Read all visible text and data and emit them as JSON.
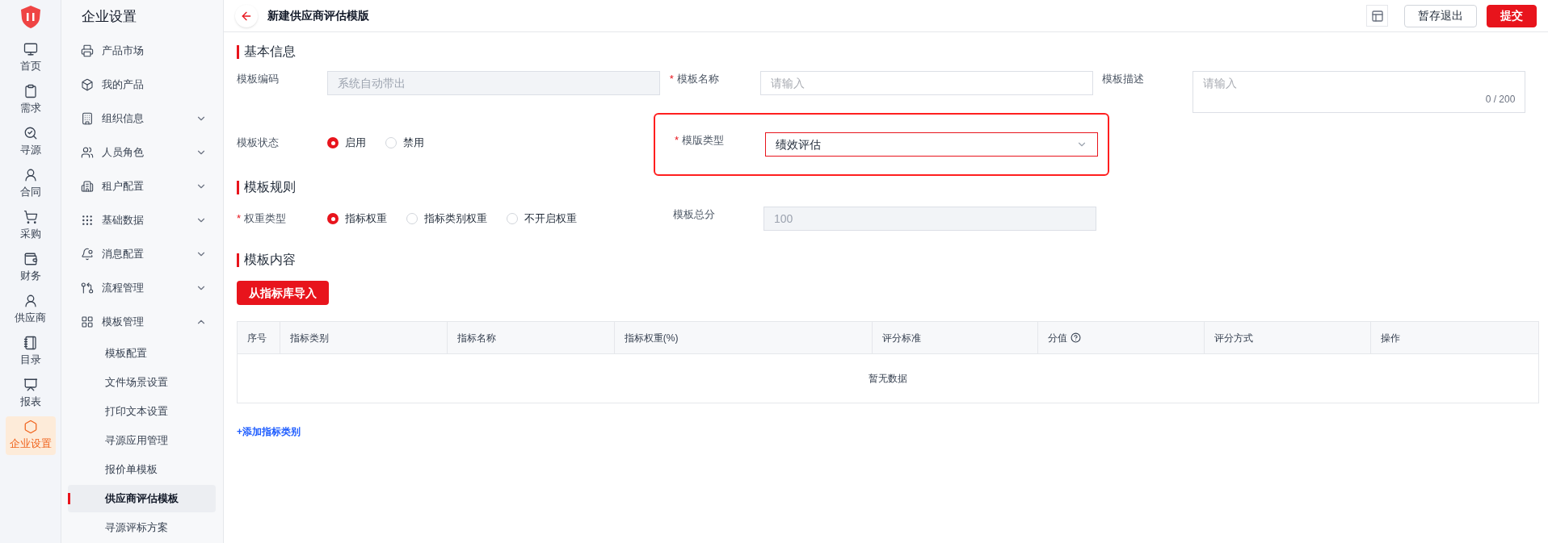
{
  "rail": [
    {
      "label": "首页",
      "selected": false
    },
    {
      "label": "需求",
      "selected": false
    },
    {
      "label": "寻源",
      "selected": false
    },
    {
      "label": "合同",
      "selected": false
    },
    {
      "label": "采购",
      "selected": false
    },
    {
      "label": "财务",
      "selected": false
    },
    {
      "label": "供应商",
      "selected": false
    },
    {
      "label": "目录",
      "selected": false
    },
    {
      "label": "报表",
      "selected": false
    },
    {
      "label": "企业设置",
      "selected": true
    }
  ],
  "sidebar": {
    "title": "企业设置",
    "items": [
      {
        "label": "产品市场",
        "kind": "link"
      },
      {
        "label": "我的产品",
        "kind": "link"
      },
      {
        "label": "组织信息",
        "kind": "group",
        "expanded": false
      },
      {
        "label": "人员角色",
        "kind": "group",
        "expanded": false
      },
      {
        "label": "租户配置",
        "kind": "group",
        "expanded": false
      },
      {
        "label": "基础数据",
        "kind": "group",
        "expanded": false
      },
      {
        "label": "消息配置",
        "kind": "group",
        "expanded": false
      },
      {
        "label": "流程管理",
        "kind": "group",
        "expanded": false
      },
      {
        "label": "模板管理",
        "kind": "group",
        "expanded": true,
        "children": [
          {
            "label": "模板配置",
            "selected": false
          },
          {
            "label": "文件场景设置",
            "selected": false
          },
          {
            "label": "打印文本设置",
            "selected": false
          },
          {
            "label": "寻源应用管理",
            "selected": false
          },
          {
            "label": "报价单模板",
            "selected": false
          },
          {
            "label": "供应商评估模板",
            "selected": true
          },
          {
            "label": "寻源评标方案",
            "selected": false
          }
        ]
      }
    ]
  },
  "header": {
    "title": "新建供应商评估模版",
    "buttons": [
      {
        "label": "暂存退出",
        "kind": "secondary"
      },
      {
        "label": "提交",
        "kind": "primary"
      }
    ]
  },
  "sections": [
    {
      "title": "基本信息",
      "rows": [
        [
          {
            "label": "模板编码",
            "kind": "input",
            "disabled": true,
            "placeholder": "系统自动带出"
          },
          {
            "label": "模板名称",
            "required_mark": "*",
            "kind": "input",
            "disabled": false,
            "placeholder": "请输入"
          },
          {
            "label": "模板描述",
            "kind": "textarea",
            "placeholder": "请输入",
            "counter": "0 / 200"
          }
        ],
        [
          {
            "label": "模板状态",
            "kind": "radio",
            "options": [
              {
                "label": "启用",
                "selected": true
              },
              {
                "label": "禁用",
                "selected": false
              }
            ]
          },
          {
            "label": "模版类型",
            "required_mark": "*",
            "kind": "select",
            "value": "绩效评估",
            "highlighted": true
          }
        ]
      ]
    },
    {
      "title": "模板规则",
      "rows": [
        [
          {
            "label": "权重类型",
            "required_mark": "*",
            "kind": "radio",
            "options": [
              {
                "label": "指标权重",
                "selected": true
              },
              {
                "label": "指标类别权重",
                "selected": false
              },
              {
                "label": "不开启权重",
                "selected": false
              }
            ]
          },
          {
            "label": "模板总分",
            "kind": "input",
            "disabled": true,
            "value": "100"
          }
        ]
      ]
    }
  ],
  "content": {
    "title": "模板内容",
    "import_button": "从指标库导入",
    "table": {
      "columns": [
        {
          "label": "序号",
          "help": false
        },
        {
          "label": "指标类别",
          "help": false
        },
        {
          "label": "指标名称",
          "help": false
        },
        {
          "label": "指标权重(%)",
          "help": false
        },
        {
          "label": "评分标准",
          "help": false
        },
        {
          "label": "分值",
          "help": true
        },
        {
          "label": "评分方式",
          "help": false
        },
        {
          "label": "操作",
          "help": false
        }
      ],
      "empty": "暂无数据"
    },
    "add_link": "+添加指标类别"
  }
}
